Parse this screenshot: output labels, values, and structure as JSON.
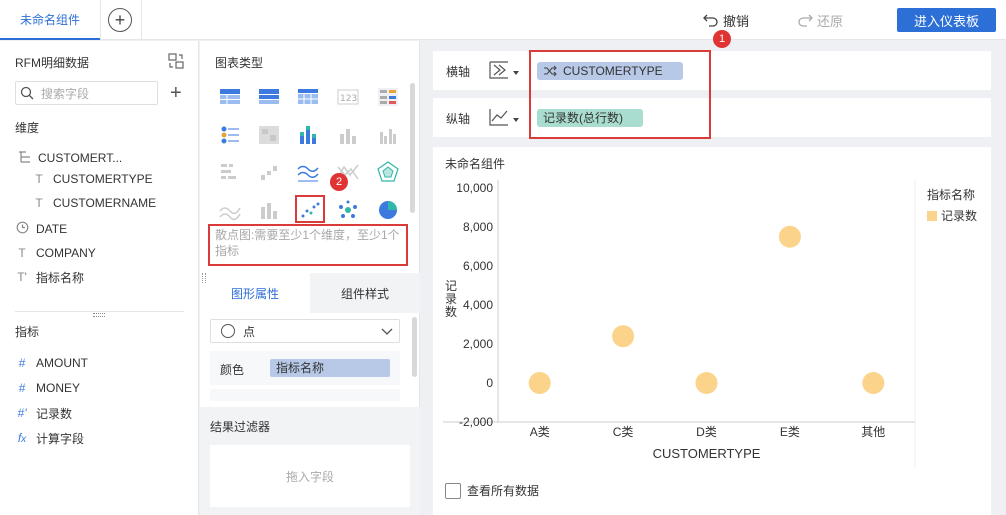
{
  "tabs": {
    "active": "未命名组件",
    "add": "+"
  },
  "toolbar": {
    "undo_label": "撤销",
    "redo_label": "还原",
    "enter_label": "进入仪表板"
  },
  "data_panel": {
    "title": "RFM明细数据",
    "search_placeholder": "搜索字段",
    "dimension_label": "维度",
    "dimensions": [
      {
        "icon": "hierarchy-icon",
        "label": "CUSTOMERT..."
      },
      {
        "icon": "text-type-icon",
        "label": "CUSTOMERTYPE"
      },
      {
        "icon": "text-type-icon",
        "label": "CUSTOMERNAME"
      },
      {
        "icon": "clock-icon",
        "label": "DATE"
      },
      {
        "icon": "text-type-icon",
        "label": "COMPANY"
      },
      {
        "icon": "text-type-icon",
        "label": "指标名称"
      }
    ],
    "measure_label": "指标",
    "measures": [
      {
        "icon": "hash-icon",
        "label": "AMOUNT"
      },
      {
        "icon": "hash-icon",
        "label": "MONEY"
      },
      {
        "icon": "hash-icon",
        "label": "记录数"
      },
      {
        "icon": "fx-icon",
        "label": "计算字段"
      }
    ]
  },
  "chart_type_panel": {
    "title": "图表类型",
    "hint": "散点图:需要至少1个维度，至少1个指标",
    "tab_attrs": "图形属性",
    "tab_style": "组件样式",
    "shape_select": "点",
    "color_label": "颜色",
    "color_field": "指标名称",
    "filter_title": "结果过滤器",
    "filter_drop": "拖入字段",
    "badge_1": "1",
    "badge_2": "2"
  },
  "axes": {
    "x_label": "横轴",
    "x_field": "CUSTOMERTYPE",
    "y_label": "纵轴",
    "y_field": "记录数(总行数)"
  },
  "chart": {
    "title": "未命名组件",
    "legend_title": "指标名称",
    "show_all_label": "查看所有数据"
  },
  "chart_data": {
    "type": "scatter",
    "xlabel": "CUSTOMERTYPE",
    "ylabel": "记录数",
    "categories": [
      "A类",
      "C类",
      "D类",
      "E类",
      "其他"
    ],
    "series": [
      {
        "name": "记录数",
        "values": [
          0,
          2400,
          0,
          7500,
          0
        ],
        "color": "#fbd38a"
      }
    ],
    "ylim": [
      -2000,
      10000
    ],
    "yticks": [
      "10,000",
      "8,000",
      "6,000",
      "4,000",
      "2,000",
      "0",
      "-2,000"
    ],
    "legend_placement": "right",
    "grid": false
  }
}
